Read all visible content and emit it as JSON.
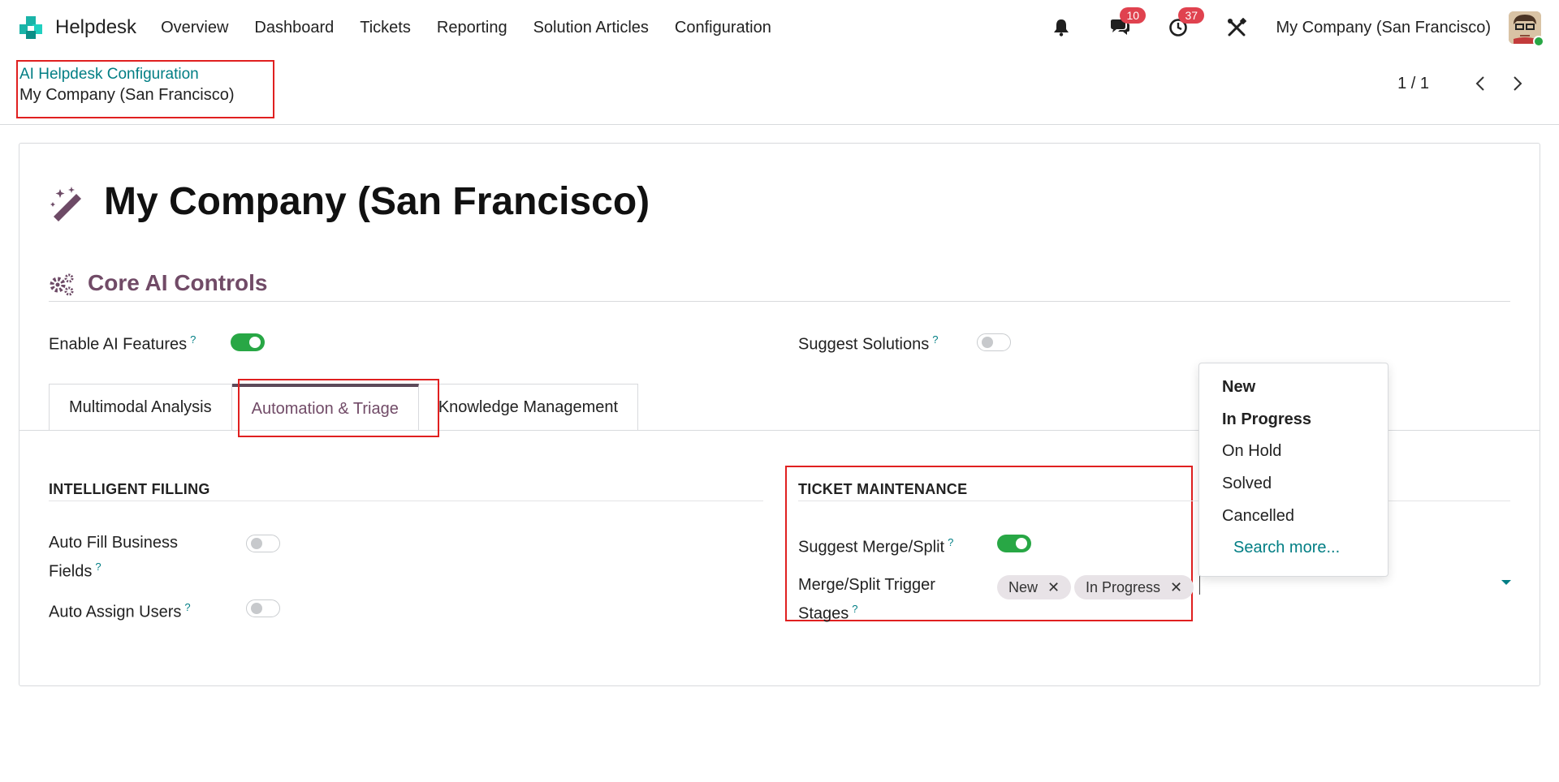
{
  "nav": {
    "app_name": "Helpdesk",
    "menu": [
      "Overview",
      "Dashboard",
      "Tickets",
      "Reporting",
      "Solution Articles",
      "Configuration"
    ],
    "messages_count": "10",
    "activities_count": "37",
    "company": "My Company (San Francisco)",
    "icons": {
      "notifications": "bell-icon",
      "messages": "chat-icon",
      "activities": "clock-icon",
      "debug": "tools-icon"
    }
  },
  "breadcrumb": {
    "parent": "AI Helpdesk Configuration",
    "current": "My Company (San Francisco)"
  },
  "pager": {
    "value": "1 / 1"
  },
  "record": {
    "title": "My Company (San Francisco)",
    "title_icon": "magic-wand-icon"
  },
  "core": {
    "section_title": "Core AI Controls",
    "section_icon": "gears-icon",
    "enable_ai_label": "Enable AI Features",
    "enable_ai_value": true,
    "suggest_solutions_label": "Suggest Solutions",
    "suggest_solutions_value": false,
    "help_mark": "?"
  },
  "tabs": [
    {
      "label": "Multimodal Analysis",
      "active": false
    },
    {
      "label": "Automation & Triage",
      "active": true
    },
    {
      "label": "Knowledge Management",
      "active": false
    }
  ],
  "intelligent_filling": {
    "title": "INTELLIGENT FILLING",
    "auto_fill_label_line1": "Auto Fill Business",
    "auto_fill_label_line2": "Fields",
    "auto_fill_value": false,
    "auto_assign_label": "Auto Assign Users",
    "auto_assign_value": false
  },
  "ticket_maintenance": {
    "title": "TICKET MAINTENANCE",
    "suggest_merge_label": "Suggest Merge/Split",
    "suggest_merge_value": true,
    "trigger_label_line1": "Merge/Split Trigger",
    "trigger_label_line2": "Stages",
    "selected_stages": [
      "New",
      "In Progress"
    ],
    "remove_mark": "✕"
  },
  "dropdown": {
    "options": [
      {
        "label": "New",
        "selected": true
      },
      {
        "label": "In Progress",
        "selected": true
      },
      {
        "label": "On Hold",
        "selected": false
      },
      {
        "label": "Solved",
        "selected": false
      },
      {
        "label": "Cancelled",
        "selected": false
      }
    ],
    "search_more": "Search more..."
  },
  "colors": {
    "accent": "#714b67",
    "link": "#017e84",
    "toggle_on": "#28a745",
    "badge": "#e0424f",
    "highlight": "#e02020"
  }
}
